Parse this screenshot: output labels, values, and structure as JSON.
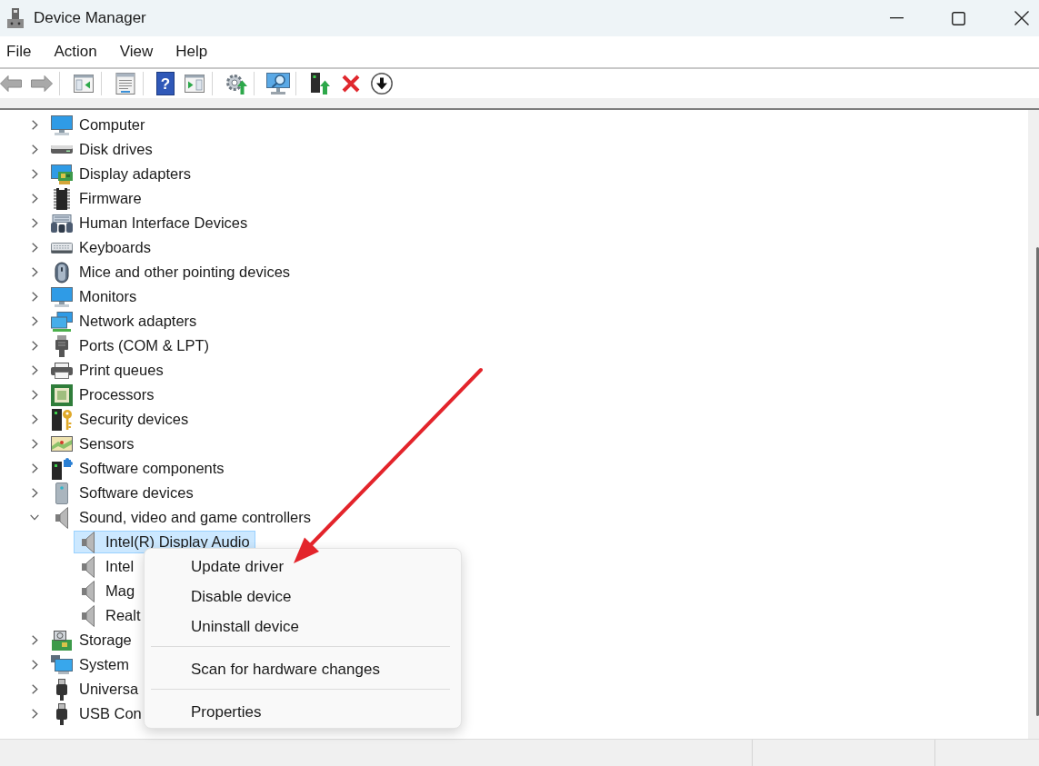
{
  "window": {
    "title": "Device Manager"
  },
  "menu_bar": [
    "File",
    "Action",
    "View",
    "Help"
  ],
  "toolbar": {
    "groups": [
      {
        "buttons": [
          {
            "disabled": true
          },
          {
            "disabled": true
          }
        ]
      },
      {
        "buttons": [
          {
            "disabled": false
          }
        ]
      },
      {
        "buttons": [
          {
            "disabled": false
          }
        ]
      },
      {
        "buttons": [
          {
            "label": "?",
            "disabled": false
          },
          {
            "disabled": false
          }
        ]
      },
      {
        "buttons": [
          {
            "disabled": false
          }
        ]
      },
      {
        "buttons": [
          {
            "disabled": false
          }
        ]
      },
      {
        "buttons": [
          {
            "disabled": false
          },
          {
            "disabled": false
          },
          {
            "disabled": false
          }
        ]
      }
    ]
  },
  "tree": [
    {
      "label": "Computer",
      "expanded": false,
      "selected": false
    },
    {
      "label": "Disk drives",
      "expanded": false,
      "selected": false
    },
    {
      "label": "Display adapters",
      "expanded": false,
      "selected": false
    },
    {
      "label": "Firmware",
      "expanded": false,
      "selected": false
    },
    {
      "label": "Human Interface Devices",
      "expanded": false,
      "selected": false
    },
    {
      "label": "Keyboards",
      "expanded": false,
      "selected": false
    },
    {
      "label": "Mice and other pointing devices",
      "expanded": false,
      "selected": false
    },
    {
      "label": "Monitors",
      "expanded": false,
      "selected": false
    },
    {
      "label": "Network adapters",
      "expanded": false,
      "selected": false
    },
    {
      "label": "Ports (COM & LPT)",
      "expanded": false,
      "selected": false
    },
    {
      "label": "Print queues",
      "expanded": false,
      "selected": false
    },
    {
      "label": "Processors",
      "expanded": false,
      "selected": false
    },
    {
      "label": "Security devices",
      "expanded": false,
      "selected": false
    },
    {
      "label": "Sensors",
      "expanded": false,
      "selected": false
    },
    {
      "label": "Software components",
      "expanded": false,
      "selected": false
    },
    {
      "label": "Software devices",
      "expanded": false,
      "selected": false
    },
    {
      "label": "Sound, video and game controllers",
      "expanded": true,
      "selected": false,
      "children": [
        {
          "label": "Intel(R) Display Audio",
          "selected": true
        },
        {
          "label": "Intel",
          "selected": false
        },
        {
          "label": "Mag",
          "selected": false
        },
        {
          "label": "Realt",
          "selected": false
        }
      ]
    },
    {
      "label": "Storage",
      "expanded": false,
      "selected": false
    },
    {
      "label": "System",
      "expanded": false,
      "selected": false
    },
    {
      "label": "Universa",
      "expanded": false,
      "selected": false
    },
    {
      "label": "USB Con",
      "expanded": false,
      "selected": false
    }
  ],
  "context_menu": {
    "groups": [
      {
        "items": [
          "Update driver",
          "Disable device",
          "Uninstall device"
        ]
      },
      {
        "items": [
          "Scan for hardware changes"
        ]
      },
      {
        "items": [
          "Properties"
        ]
      }
    ]
  },
  "annotations": [
    {
      "kind": "arrow"
    }
  ]
}
